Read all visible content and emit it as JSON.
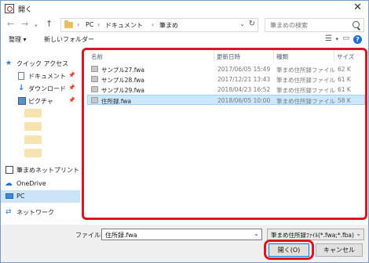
{
  "window": {
    "title": "開く"
  },
  "address": {
    "crumbs": [
      "PC",
      "ドキュメント",
      "筆まめ"
    ],
    "separator": "›"
  },
  "search": {
    "placeholder": "筆まめの検索"
  },
  "toolbar": {
    "organize": "整理 ▾",
    "new_folder": "新しいフォルダー"
  },
  "nav": {
    "quick_access": "クイック アクセス",
    "documents": "ドキュメント",
    "downloads": "ダウンロード",
    "pictures": "ピクチャ",
    "app": "筆まめネットプリント",
    "onedrive": "OneDrive",
    "pc": "PC",
    "network": "ネットワーク"
  },
  "columns": {
    "name": "名前",
    "date": "更新日時",
    "type": "種類",
    "size": "サイズ"
  },
  "files": [
    {
      "name": "サンプル27.fwa",
      "date": "2017/06/05 15:49",
      "type": "筆まめ住所録ファイル",
      "size": "62 K"
    },
    {
      "name": "サンプル28.fwa",
      "date": "2017/12/21 13:43",
      "type": "筆まめ住所録ファイル",
      "size": "61 K"
    },
    {
      "name": "サンプル29.fwa",
      "date": "2018/04/23 16:52",
      "type": "筆まめ住所録ファイル",
      "size": "61 K"
    },
    {
      "name": "住所録.fwa",
      "date": "2018/06/05 10:00",
      "type": "筆まめ住所録ファイル",
      "size": "58 K"
    }
  ],
  "filename": {
    "label": "ファイル名(N):",
    "value": "住所録.fwa"
  },
  "filetype": {
    "value": "筆まめ住所録ﾌｧｲﾙ(*.fwa;*.fba)"
  },
  "buttons": {
    "open": "開く(O)",
    "cancel": "キャンセル"
  },
  "colors": {
    "accent": "#0078d7",
    "highlight": "#e0141e",
    "selection": "#cce8ff"
  }
}
